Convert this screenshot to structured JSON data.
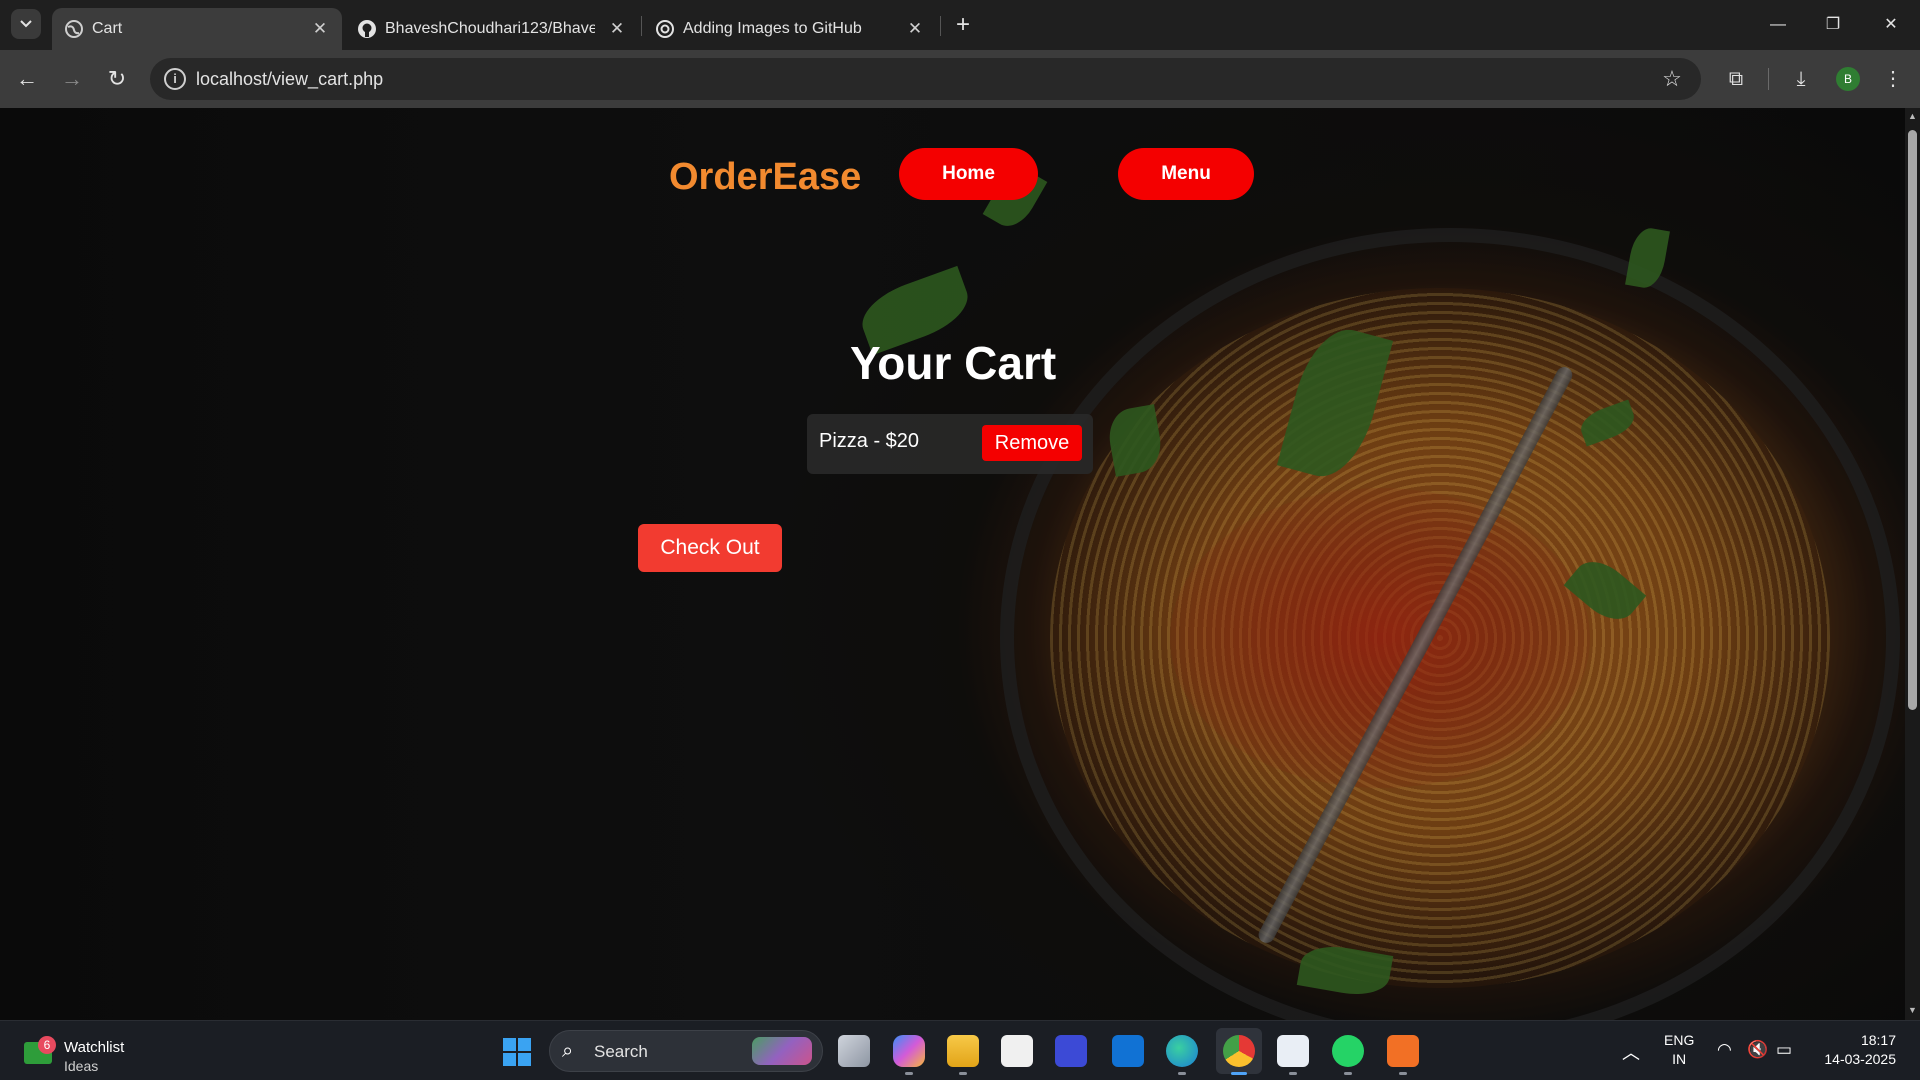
{
  "browser": {
    "tabs": [
      {
        "title": "Cart",
        "active": true,
        "favicon": "globe-icon"
      },
      {
        "title": "BhaveshChoudhari123/Bhavesh",
        "active": false,
        "favicon": "github-icon"
      },
      {
        "title": "Adding Images to GitHub",
        "active": false,
        "favicon": "openai-icon"
      }
    ],
    "url": "localhost/view_cart.php",
    "profile_initial": "B"
  },
  "page": {
    "brand": "OrderEase",
    "nav": {
      "home": "Home",
      "menu": "Menu"
    },
    "cart_title": "Your Cart",
    "cart_items": [
      {
        "label": "Pizza - $20",
        "remove_label": "Remove"
      }
    ],
    "checkout_label": "Check Out",
    "colors": {
      "accent": "#f40000",
      "brand": "#f28a2f",
      "checkout": "#f23b30"
    }
  },
  "taskbar": {
    "widget": {
      "title": "Watchlist",
      "subtitle": "Ideas",
      "badge": "6"
    },
    "search_placeholder": "Search",
    "language": {
      "line1": "ENG",
      "line2": "IN"
    },
    "time": "18:17",
    "date": "14-03-2025"
  }
}
